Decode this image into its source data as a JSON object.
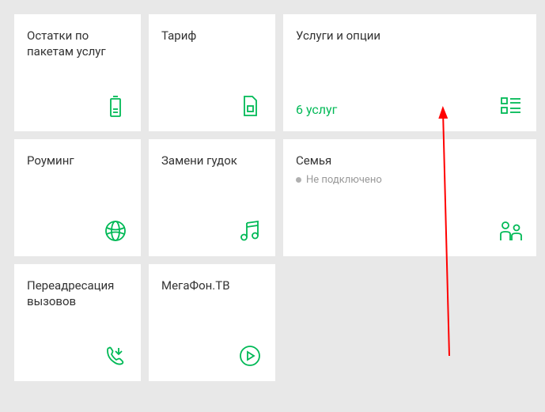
{
  "colors": {
    "accent": "#00b956",
    "bg": "#e8e8e8",
    "tile_bg": "#ffffff",
    "text": "#333333",
    "muted": "#999999"
  },
  "tiles": {
    "balances": {
      "title": "Остатки по пакетам услуг"
    },
    "tariff": {
      "title": "Тариф"
    },
    "services": {
      "title": "Услуги и опции",
      "value": "6 услуг"
    },
    "roaming": {
      "title": "Роуминг"
    },
    "ringtone": {
      "title": "Замени гудок"
    },
    "family": {
      "title": "Семья",
      "status": "Не подключено"
    },
    "forwarding": {
      "title": "Переадресация вызовов"
    },
    "tv": {
      "title": "МегаФон.ТВ"
    }
  }
}
